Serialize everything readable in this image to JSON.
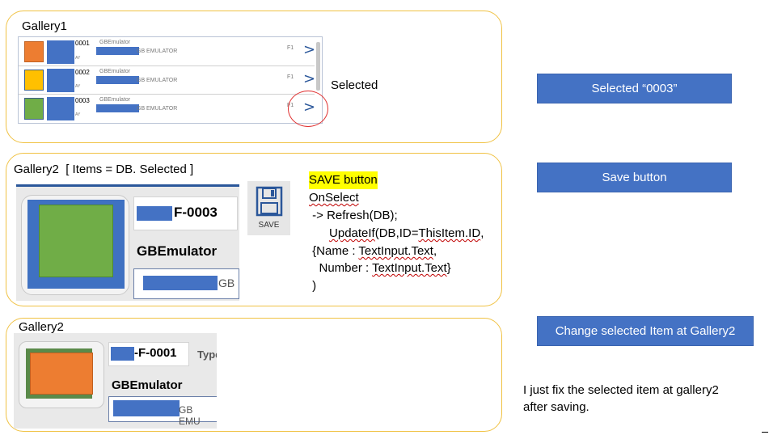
{
  "gallery1": {
    "title": "Gallery1",
    "rows": [
      {
        "id": "0001",
        "name": "GBEmulator",
        "desc": "GB EMULATOR",
        "sub": "AY",
        "tag": "F1",
        "color": "#ed7d31"
      },
      {
        "id": "0002",
        "name": "GBEmulator",
        "desc": "GB EMULATOR",
        "sub": "AY",
        "tag": "F1",
        "color": "#ffc000"
      },
      {
        "id": "0003",
        "name": "GBEmulator",
        "desc": "GB EMULATOR",
        "sub": "AY",
        "tag": "F1",
        "color": "#70ad47"
      }
    ],
    "selected_note": "Selected"
  },
  "gallery2_top": {
    "title": "Gallery2  [ Items = DB. Selected ]",
    "item_code": "F-0003",
    "name": "GBEmulator",
    "input_suffix": "GB",
    "image_color": "#70ad47"
  },
  "save_icon": {
    "label": "SAVE"
  },
  "code": {
    "heading": "SAVE button",
    "line1": "OnSelect",
    "line2": " -> Refresh(DB);",
    "line3_pre": "      ",
    "line3_a": "UpdateIf",
    "line3_b": "(DB,ID=",
    "line3_c": "ThisItem.ID",
    "line3_d": ",",
    "line4_pre": " {Name : ",
    "line4_a": "TextInput.Text",
    "line4_b": ",",
    "line5_pre": "   Number : ",
    "line5_a": "TextInput.Text",
    "line5_b": "}",
    "line6": " )"
  },
  "gallery2_bottom": {
    "title": "Gallery2",
    "item_code": "-F-0001",
    "type_label": "Type",
    "name": "GBEmulator",
    "input_suffix": "GB EMU",
    "image_color": "#ed7d31"
  },
  "buttons": {
    "selected": "Selected “0003”",
    "save": "Save button",
    "change": "Change selected Item at Gallery2"
  },
  "note": {
    "line1": "I just fix the selected item at gallery2",
    "line2": "after saving."
  },
  "colors": {
    "accent_blue": "#4472c4",
    "panel_border": "#f0c244",
    "highlight": "#ffff00"
  }
}
